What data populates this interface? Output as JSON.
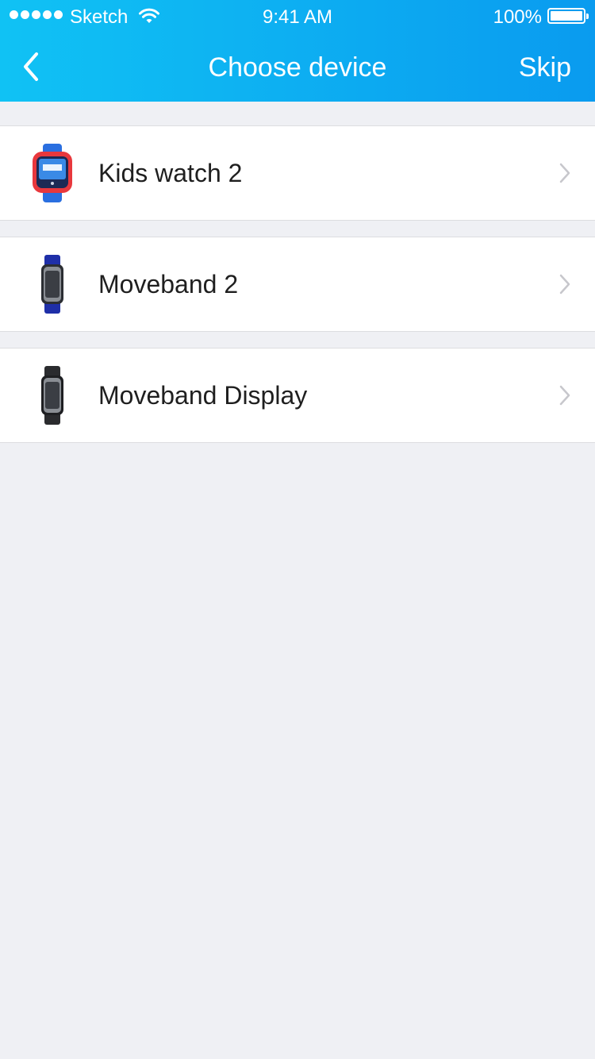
{
  "status_bar": {
    "carrier": "Sketch",
    "time": "9:41 AM",
    "battery_percent": "100%",
    "signal_bars": 5,
    "battery_level": 1.0
  },
  "nav": {
    "title": "Choose device",
    "skip_label": "Skip",
    "back_icon": "chevron-left-icon"
  },
  "devices": [
    {
      "label": "Kids watch 2",
      "icon": "kids-watch-icon"
    },
    {
      "label": "Moveband 2",
      "icon": "moveband-blue-icon"
    },
    {
      "label": "Moveband Display",
      "icon": "moveband-black-icon"
    }
  ],
  "colors": {
    "header_start": "#10c2f4",
    "header_end": "#0a9bef",
    "background": "#eff0f4",
    "chevron": "#c7c7cc"
  }
}
